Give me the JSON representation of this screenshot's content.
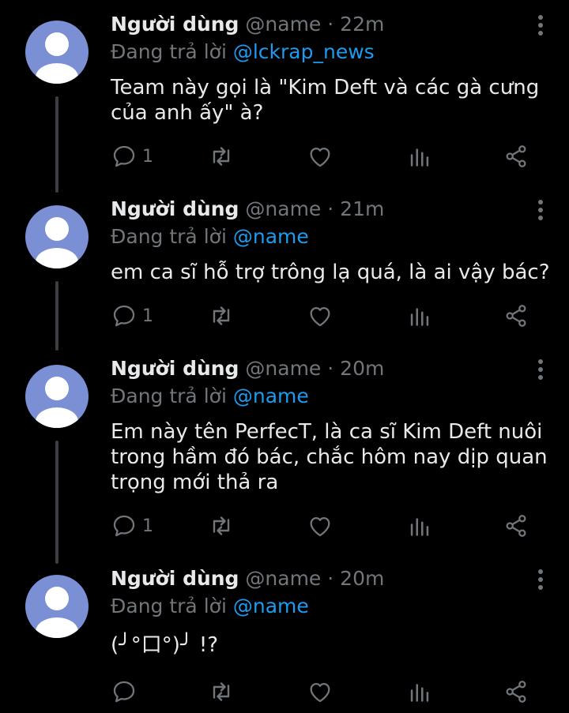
{
  "thread": {
    "replies": [
      {
        "name": "Người dùng",
        "handle": "@name",
        "separator": "·",
        "time": "22m",
        "replying_label": "Đang trả lời",
        "replying_to": "@lckrap_news",
        "text": "Team này gọi là \"Kim Deft và các gà cưng của anh ấy\" à?",
        "reply_count": "1"
      },
      {
        "name": "Người dùng",
        "handle": "@name",
        "separator": "·",
        "time": "21m",
        "replying_label": "Đang trả lời",
        "replying_to": "@name",
        "text": "em ca sĩ hỗ trợ trông lạ quá, là ai vậy bác?",
        "reply_count": "1"
      },
      {
        "name": "Người dùng",
        "handle": "@name",
        "separator": "·",
        "time": "20m",
        "replying_label": "Đang trả lời",
        "replying_to": "@name",
        "text": "Em này tên PerfecT, là ca sĩ Kim Deft nuôi trong hầm đó bác, chắc hôm nay dịp quan trọng mới thả ra",
        "reply_count": "1"
      },
      {
        "name": "Người dùng",
        "handle": "@name",
        "separator": "·",
        "time": "20m",
        "replying_label": "Đang trả lời",
        "replying_to": "@name",
        "text": "(╯°口°)╯ !?",
        "reply_count": ""
      }
    ]
  },
  "icons": {
    "avatar": "default-avatar-icon",
    "more": "more-vertical-icon",
    "reply": "reply-icon",
    "retweet": "retweet-icon",
    "like": "heart-icon",
    "views": "views-icon",
    "share": "share-icon"
  },
  "colors": {
    "background": "#000000",
    "text": "#e7e9ea",
    "muted": "#71767b",
    "link": "#1d9bf0",
    "avatar_bg": "#7b8fd4",
    "avatar_fg": "#ffffff",
    "thread_line": "#3a3d41"
  }
}
